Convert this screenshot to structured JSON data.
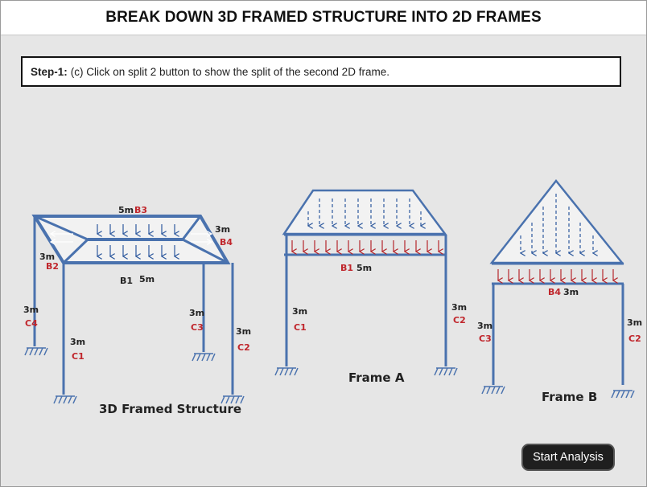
{
  "title": "BREAK DOWN 3D FRAMED STRUCTURE INTO 2D FRAMES",
  "step": {
    "label": "Step-1:",
    "text": "(c) Click on split 2 button to show the split of the second 2D frame."
  },
  "diagram": {
    "frame3d": {
      "caption": "3D Framed Structure",
      "labels": {
        "b3_len": "5m",
        "b3": "B3",
        "b4_len": "3m",
        "b4": "B4",
        "b2_len": "3m",
        "b2": "B2",
        "b1": "B1",
        "b1_len": "5m",
        "c4_len": "3m",
        "c4": "C4",
        "c1_len": "3m",
        "c1": "C1",
        "c3_len": "3m",
        "c3": "C3",
        "c2_len": "3m",
        "c2": "C2"
      }
    },
    "frameA": {
      "caption": "Frame A",
      "labels": {
        "b1": "B1",
        "b1_len": "5m",
        "c1_len": "3m",
        "c1": "C1",
        "c2_len": "3m",
        "c2": "C2"
      }
    },
    "frameB": {
      "caption": "Frame B",
      "labels": {
        "b4": "B4",
        "b4_len": "3m",
        "c3_len": "3m",
        "c3": "C3",
        "c2_len": "3m",
        "c2": "C2"
      }
    },
    "colors": {
      "member": "#4a72ae",
      "label": "#c0262c",
      "load": "#2f5a9e",
      "udl": "#b5262c"
    }
  },
  "button": {
    "label": "Start Analysis"
  }
}
